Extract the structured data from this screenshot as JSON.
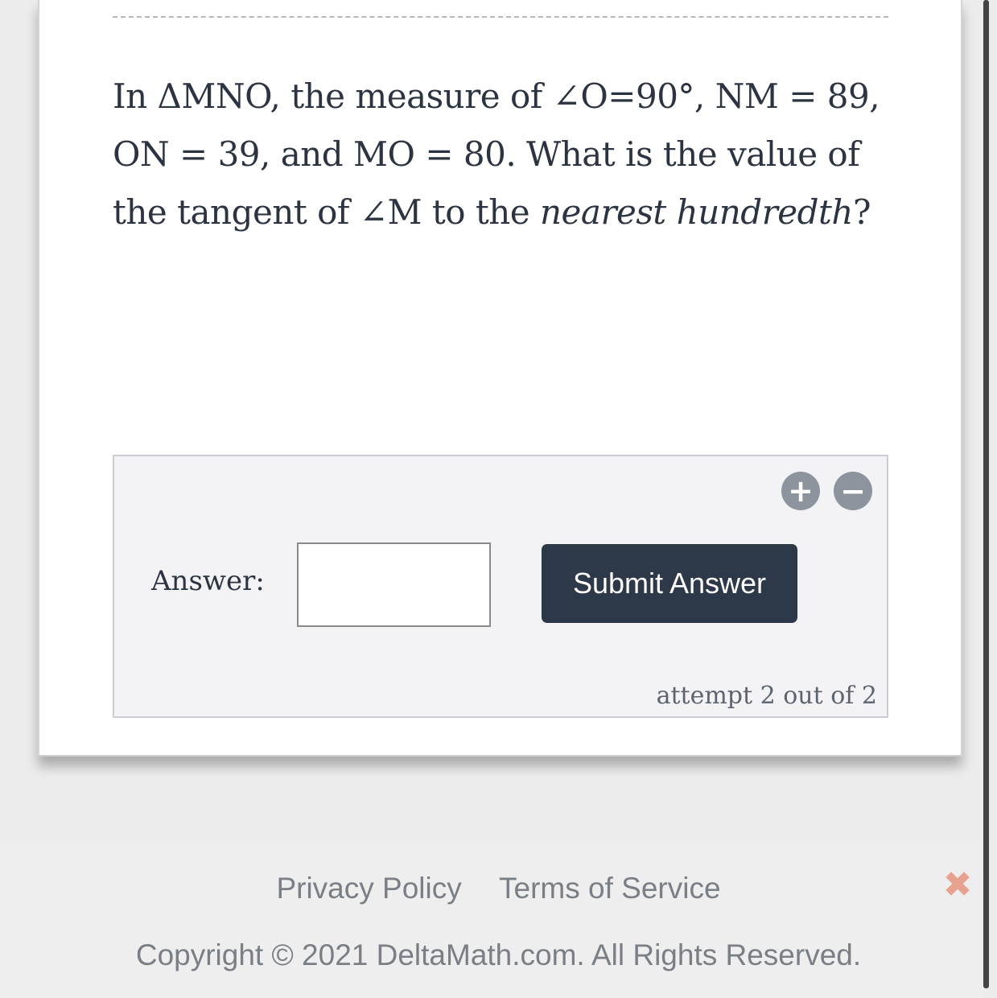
{
  "question": {
    "part1": "In ΔMNO, the measure of ∠O=90°, NM = 89, ON = 39, and MO = 80. What is the value of the tangent of ∠M to the ",
    "italic1": "nearest hundredth",
    "part2": "?"
  },
  "answer_panel": {
    "label": "Answer:",
    "input_value": "",
    "submit_label": "Submit Answer",
    "zoom_in_symbol": "+",
    "zoom_out_symbol": "−",
    "attempt_text": "attempt 2 out of 2"
  },
  "footer": {
    "privacy_label": "Privacy Policy",
    "terms_label": "Terms of Service",
    "copyright": "Copyright © 2021 DeltaMath.com. All Rights Reserved.",
    "close_symbol": "✖"
  },
  "colors": {
    "submit_bg": "#2d3848",
    "close_accent": "#e7a18f",
    "zoom_icon": "#8d949e"
  }
}
